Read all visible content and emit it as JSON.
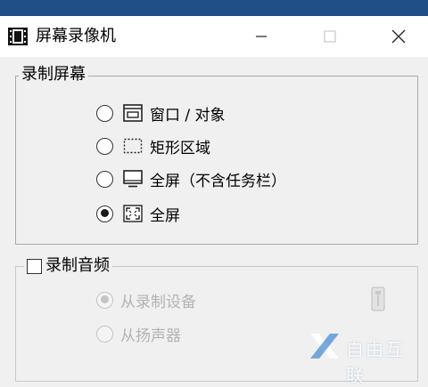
{
  "window": {
    "title": "屏幕录像机"
  },
  "screen_group": {
    "label": "录制屏幕",
    "options": [
      {
        "label": "窗口 / 对象",
        "icon": "window-icon",
        "checked": false
      },
      {
        "label": "矩形区域",
        "icon": "dashed-rect-icon",
        "checked": false
      },
      {
        "label": "全屏（不含任务栏）",
        "icon": "monitor-icon",
        "checked": false
      },
      {
        "label": "全屏",
        "icon": "fullscreen-corners-icon",
        "checked": true
      }
    ]
  },
  "audio_group": {
    "label": "录制音频",
    "checked": false,
    "options": [
      {
        "label": "从录制设备",
        "checked": true,
        "disabled": true
      },
      {
        "label": "从扬声器",
        "checked": false,
        "disabled": true
      }
    ]
  },
  "watermark": {
    "text": "自由互联"
  },
  "colors": {
    "accent": "#1f4f86",
    "disabled_text": "#b3b3b3"
  }
}
